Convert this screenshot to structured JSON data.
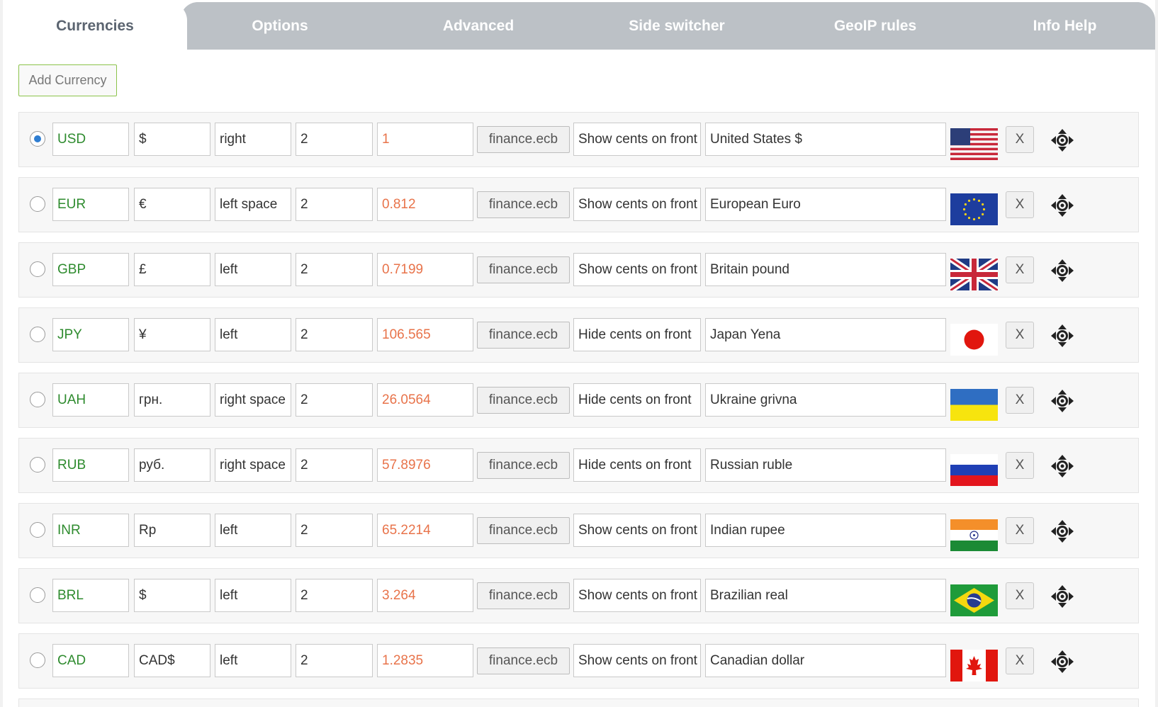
{
  "tabs": [
    {
      "label": "Currencies",
      "active": true
    },
    {
      "label": "Options"
    },
    {
      "label": "Advanced"
    },
    {
      "label": "Side switcher"
    },
    {
      "label": "GeoIP rules"
    },
    {
      "label": "Info Help"
    }
  ],
  "add_button": "Add Currency",
  "delete_label": "X",
  "rows": [
    {
      "code": "USD",
      "symbol": "$",
      "position": "right",
      "decimals": "2",
      "rate": "1",
      "source": "finance.ecb",
      "cents": "Show cents on front",
      "description": "United States $",
      "flag": "us-flag-icon",
      "selected": true
    },
    {
      "code": "EUR",
      "symbol": "€",
      "position": "left space",
      "decimals": "2",
      "rate": "0.812",
      "source": "finance.ecb",
      "cents": "Show cents on front",
      "description": "European Euro",
      "flag": "eu-flag-icon"
    },
    {
      "code": "GBP",
      "symbol": "£",
      "position": "left",
      "decimals": "2",
      "rate": "0.7199",
      "source": "finance.ecb",
      "cents": "Show cents on front",
      "description": "Britain pound",
      "flag": "gb-flag-icon"
    },
    {
      "code": "JPY",
      "symbol": "¥",
      "position": "left",
      "decimals": "2",
      "rate": "106.565",
      "source": "finance.ecb",
      "cents": "Hide cents on front",
      "description": "Japan Yena",
      "flag": "jp-flag-icon"
    },
    {
      "code": "UAH",
      "symbol": "грн.",
      "position": "right space",
      "decimals": "2",
      "rate": "26.0564",
      "source": "finance.ecb",
      "cents": "Hide cents on front",
      "description": "Ukraine grivna",
      "flag": "ua-flag-icon"
    },
    {
      "code": "RUB",
      "symbol": "руб.",
      "position": "right space",
      "decimals": "2",
      "rate": "57.8976",
      "source": "finance.ecb",
      "cents": "Hide cents on front",
      "description": "Russian ruble",
      "flag": "ru-flag-icon"
    },
    {
      "code": "INR",
      "symbol": "Rp",
      "position": "left",
      "decimals": "2",
      "rate": "65.2214",
      "source": "finance.ecb",
      "cents": "Show cents on front",
      "description": "Indian rupee",
      "flag": "in-flag-icon"
    },
    {
      "code": "BRL",
      "symbol": "$",
      "position": "left",
      "decimals": "2",
      "rate": "3.264",
      "source": "finance.ecb",
      "cents": "Show cents on front",
      "description": "Brazilian real",
      "flag": "br-flag-icon"
    },
    {
      "code": "CAD",
      "symbol": "CAD$",
      "position": "left",
      "decimals": "2",
      "rate": "1.2835",
      "source": "finance.ecb",
      "cents": "Show cents on front",
      "description": "Canadian dollar",
      "flag": "ca-flag-icon"
    }
  ],
  "colors": {
    "accent_green": "#2e8b2e",
    "rate_orange": "#e8734a",
    "tab_gray": "#bcc1c6",
    "radio_blue": "#2e7dd1"
  }
}
